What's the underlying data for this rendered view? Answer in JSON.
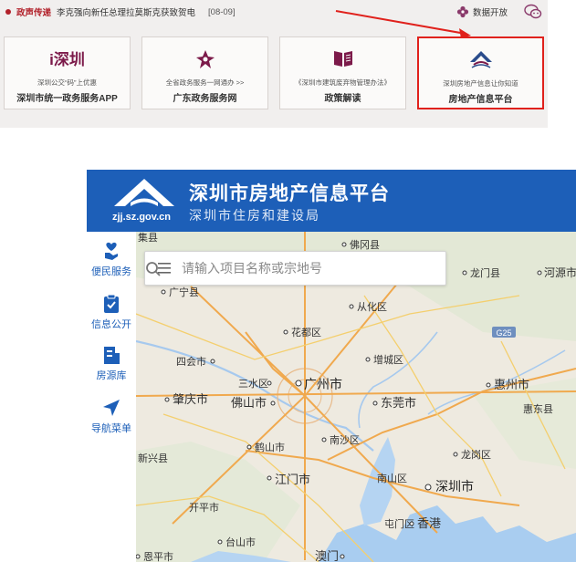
{
  "topbar": {
    "news_tag": "政声传递",
    "news_text": "李克强向新任总理拉莫斯克获致贺电",
    "news_date": "[08-09]",
    "data_open": "数据开放"
  },
  "cards": [
    {
      "brand": "i深圳",
      "sub": "深圳公交“码”上优惠",
      "main": "深圳市统一政务服务APP",
      "icon": "i-shenzhen-logo"
    },
    {
      "sub": "全省政务服务一网通办 >>",
      "main": "广东政务服务网",
      "icon": "guangdong-flower-icon"
    },
    {
      "sub": "《深圳市建筑废弃物管理办法》",
      "main": "政策解读",
      "icon": "book-icon"
    },
    {
      "sub": "深圳房地产信息让你知道",
      "main": "房地产信息平台",
      "icon": "house-roof-icon"
    }
  ],
  "platform": {
    "url": "zjj.sz.gov.cn",
    "title": "深圳市房地产信息平台",
    "subtitle": "深圳市住房和建设局",
    "sidebar": [
      {
        "label": "便民服务",
        "icon": "heart-hand-icon"
      },
      {
        "label": "信息公开",
        "icon": "clipboard-check-icon"
      },
      {
        "label": "房源库",
        "icon": "building-icon"
      },
      {
        "label": "导航菜单",
        "icon": "navigation-arrow-icon"
      }
    ],
    "search": {
      "placeholder": "请输入项目名称或宗地号"
    },
    "map_labels": {
      "l1": "集县",
      "l2": "佛冈县",
      "l3": "龙门县",
      "l4": "河源市",
      "l5": "广宁县",
      "l6": "从化区",
      "l7": "花都区",
      "l8": "四会市",
      "l9": "增城区",
      "l10": "三水区",
      "l11": "广州市",
      "l12": "肇庆市",
      "l13": "佛山市",
      "l14": "东莞市",
      "l15": "惠州市",
      "l16": "惠东县",
      "l17": "鹤山市",
      "l18": "南沙区",
      "l19": "龙岗区",
      "l20": "新兴县",
      "l21": "江门市",
      "l22": "南山区",
      "l23": "深圳市",
      "l24": "开平市",
      "l25": "屯门区",
      "l26": "香港",
      "l27": "台山市",
      "l28": "恩平市",
      "l29": "澳门",
      "road": "G25"
    }
  }
}
